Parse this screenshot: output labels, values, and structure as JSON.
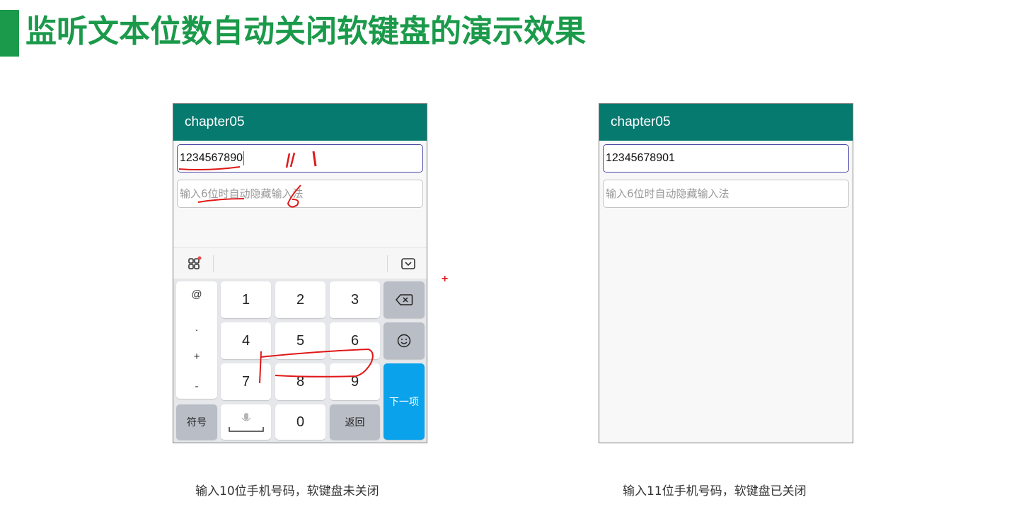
{
  "page": {
    "title": "监听文本位数自动关闭软键盘的演示效果",
    "accent_color": "#1a9a4a"
  },
  "left_phone": {
    "app_title": "chapter05",
    "phone_field_value": "1234567890",
    "password_field_placeholder": "输入6位时自动隐藏输入法",
    "keyboard": {
      "toolbar_icons": [
        "grid-icon",
        "keyboard-hide-icon"
      ],
      "symbols": [
        "@",
        ".",
        "+",
        "-"
      ],
      "digits": [
        "1",
        "2",
        "3",
        "4",
        "5",
        "6",
        "7",
        "8",
        "9",
        "0"
      ],
      "symbol_key_label": "符号",
      "back_key_label": "返回",
      "next_key_label": "下一项",
      "backspace_icon": "backspace-icon",
      "emoji_icon": "emoji-icon",
      "voice_icon": "microphone-icon",
      "space_icon": "space-icon"
    },
    "caption": "输入10位手机号码，软键盘未关闭"
  },
  "right_phone": {
    "app_title": "chapter05",
    "phone_field_value": "12345678901",
    "password_field_placeholder": "输入6位时自动隐藏输入法",
    "caption": "输入11位手机号码，软键盘已关闭"
  },
  "annotations": {
    "handwritten_11": "11",
    "handwritten_6": "6",
    "plus_mark": "+",
    "ink_color": "#e01818"
  },
  "theme": {
    "appbar_color": "#077a70",
    "next_key_color": "#0aa2ea"
  }
}
